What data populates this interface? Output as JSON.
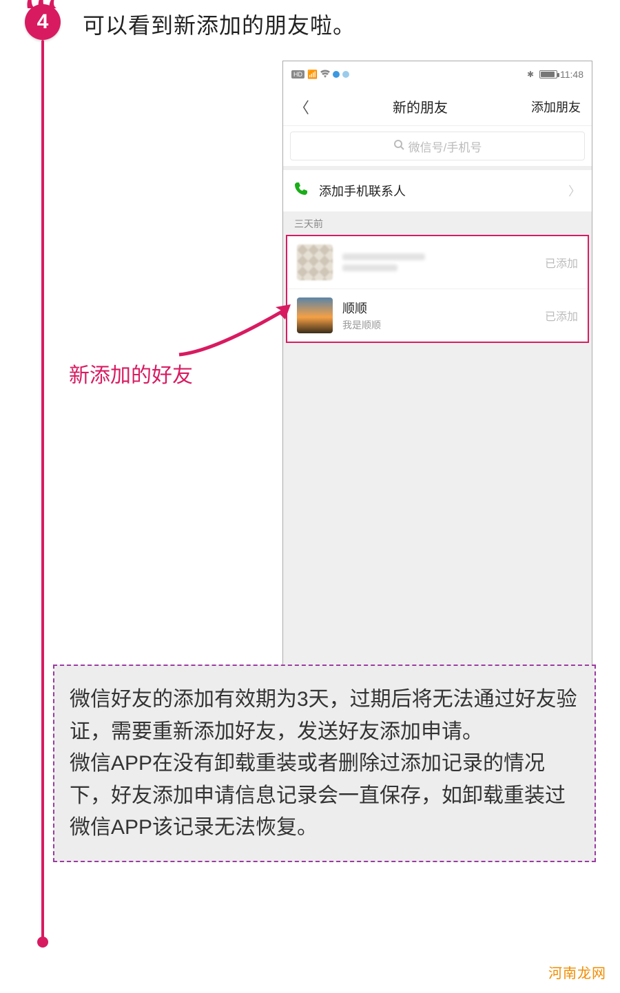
{
  "step": {
    "number": "4",
    "title": "可以看到新添加的朋友啦。"
  },
  "phone": {
    "status": {
      "hd_pill": "HD",
      "time": "11:48"
    },
    "nav": {
      "title": "新的朋友",
      "action": "添加朋友"
    },
    "search": {
      "placeholder": "微信号/手机号"
    },
    "add_contacts": {
      "label": "添加手机联系人"
    },
    "section_header": "三天前",
    "friends": [
      {
        "name": "",
        "sub": "",
        "status": "已添加"
      },
      {
        "name": "顺顺",
        "sub": "我是顺顺",
        "status": "已添加"
      }
    ]
  },
  "callout": "新添加的好友",
  "note": {
    "p1": "微信好友的添加有效期为3天，过期后将无法通过好友验证，需要重新添加好友，发送好友添加申请。",
    "p2": "微信APP在没有卸载重装或者删除过添加记录的情况下，好友添加申请信息记录会一直保存，如卸载重装过微信APP该记录无法恢复。"
  },
  "watermark": "河南龙网"
}
